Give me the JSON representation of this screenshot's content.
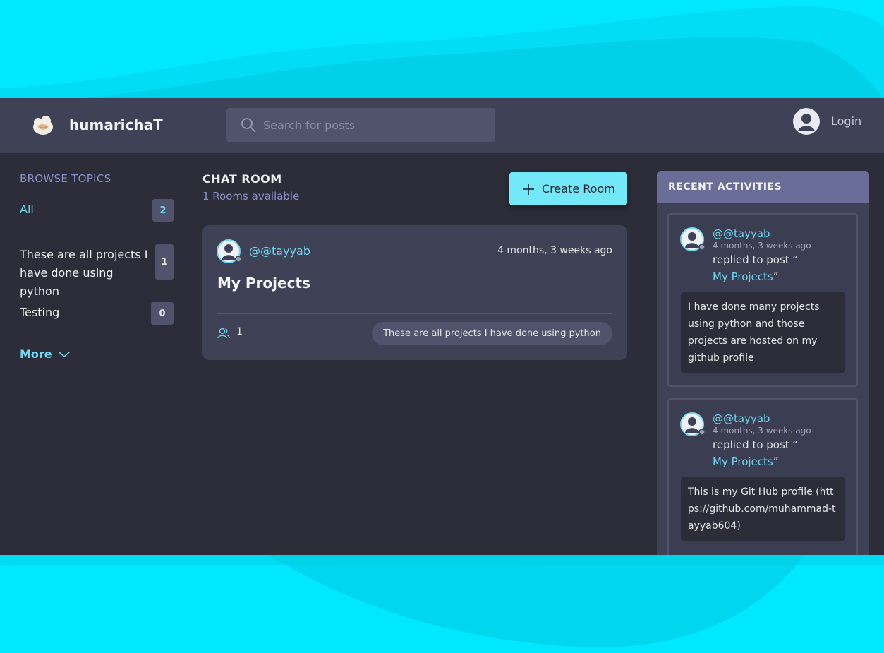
{
  "app": {
    "brand": "humarichaT"
  },
  "header": {
    "search_placeholder": "Search for posts",
    "login_label": "Login"
  },
  "sidebar": {
    "title": "BROWSE TOPICS",
    "topics": [
      {
        "label": "All",
        "count": "2"
      },
      {
        "label": "These are all projects I have done using python",
        "count": "1"
      },
      {
        "label": "Testing",
        "count": "0"
      }
    ],
    "more_label": "More"
  },
  "main": {
    "title": "CHAT ROOM",
    "subtitle": "1 Rooms available",
    "create_button": "Create Room",
    "rooms": [
      {
        "host": "@@tayyab",
        "time": "4 months, 3 weeks ago",
        "name": "My Projects",
        "participants": "1",
        "topic": "These are all projects I have done using python"
      }
    ]
  },
  "activities": {
    "title": "RECENT ACTIVITIES",
    "items": [
      {
        "user": "@@tayyab",
        "time": "4 months, 3 weeks ago",
        "action": "replied to post “",
        "post": "My Projects",
        "post_close": "”",
        "message": "I have done many projects using python and those projects are hosted on my github profile"
      },
      {
        "user": "@@tayyab",
        "time": "4 months, 3 weeks ago",
        "action": "replied to post “",
        "post": "My Projects",
        "post_close": "”",
        "message": "This is my Git Hub profile (https://github.com/muhammad-tayyab604)"
      }
    ]
  },
  "colors": {
    "accent": "#71d7ee",
    "button": "#73e8f9",
    "panel": "#3f4156",
    "background": "#2d2d39",
    "outer": "#00e8ff"
  }
}
